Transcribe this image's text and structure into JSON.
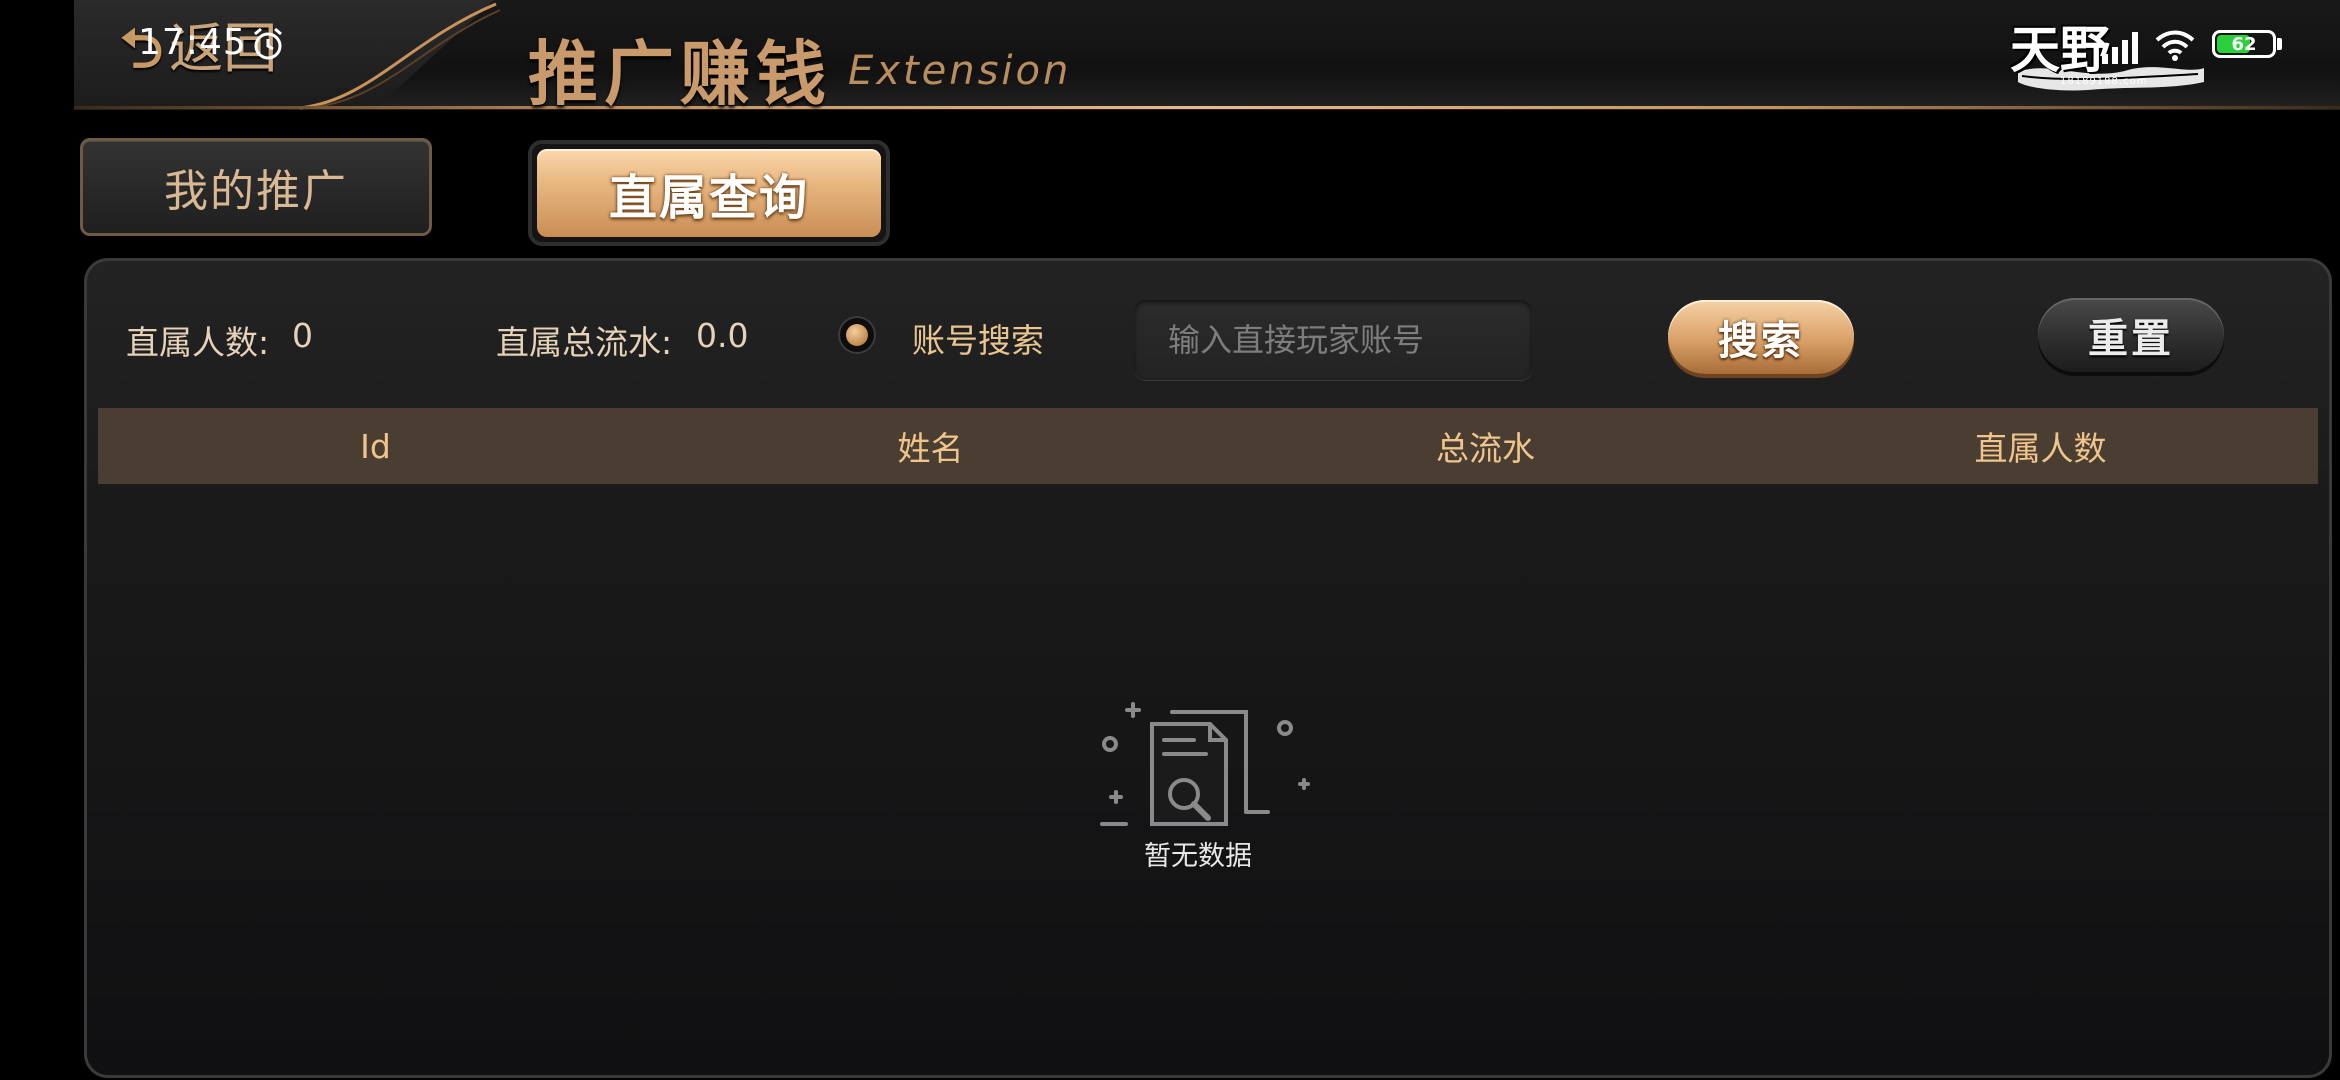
{
  "status_bar": {
    "time": "17:45",
    "battery_level": "62",
    "battery_fraction": 0.62
  },
  "header": {
    "back_label": "返回",
    "back_icon": "back-arrow-icon",
    "title": "推广赚钱",
    "subtitle": "Extension",
    "logo_text": "天野",
    "logo_url": "18189188.com"
  },
  "tabs": [
    {
      "label": "我的推广",
      "active": false
    },
    {
      "label": "直属查询",
      "active": true
    }
  ],
  "stats": {
    "direct_count_label": "直属人数:",
    "direct_count_value": "0",
    "total_flow_label": "直属总流水:",
    "total_flow_value": "0.0"
  },
  "search": {
    "radio_label": "账号搜索",
    "input_value": "",
    "placeholder": "输入直接玩家账号",
    "search_button": "搜索",
    "reset_button": "重置"
  },
  "table": {
    "columns": [
      "Id",
      "姓名",
      "总流水",
      "直属人数"
    ],
    "rows": []
  },
  "empty_state": {
    "text": "暂无数据",
    "icon": "empty-document-search-icon"
  },
  "colors": {
    "accent_gold": "#d9a068",
    "header_gold_text": "#c99a6b",
    "table_header_bg": "#4a3e33",
    "table_header_text": "#efc58b",
    "battery_green": "#2bd13a"
  }
}
